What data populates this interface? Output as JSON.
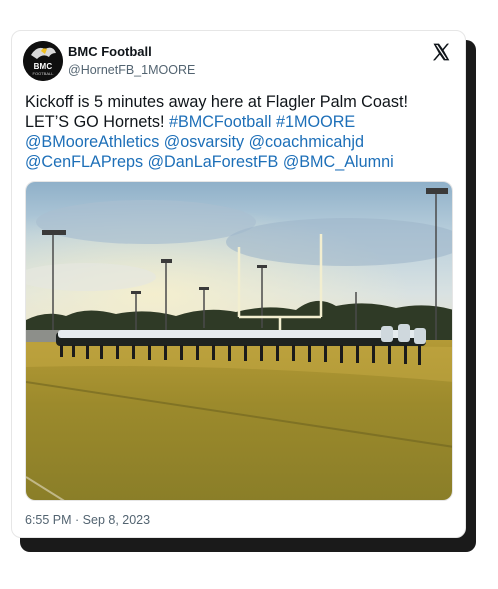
{
  "post": {
    "author_name": "BMC Football",
    "author_handle": "@HornetFB_1MOORE",
    "avatar": {
      "label": "BMC",
      "sublabel": "FOOTBALL",
      "icon": "hornet-logo"
    },
    "platform_icon": "x-logo-icon",
    "text_plain_1": "Kickoff is 5 minutes away here at Flagler Palm Coast! LET’S GO Hornets! ",
    "hashtag_1": "#BMCFootball",
    "hashtag_2": "#1MOORE",
    "mention_1": "@BMooreAthletics",
    "mention_2": "@osvarsity",
    "mention_3": "@coachmicahjd",
    "mention_4": "@CenFLAPreps",
    "mention_5": "@DanLaForestFB",
    "mention_6": "@BMC_Alumni",
    "timestamp": "6:55 PM · Sep 8, 2023",
    "link_color": "#1d6fb8",
    "text_color": "#0f1419"
  }
}
